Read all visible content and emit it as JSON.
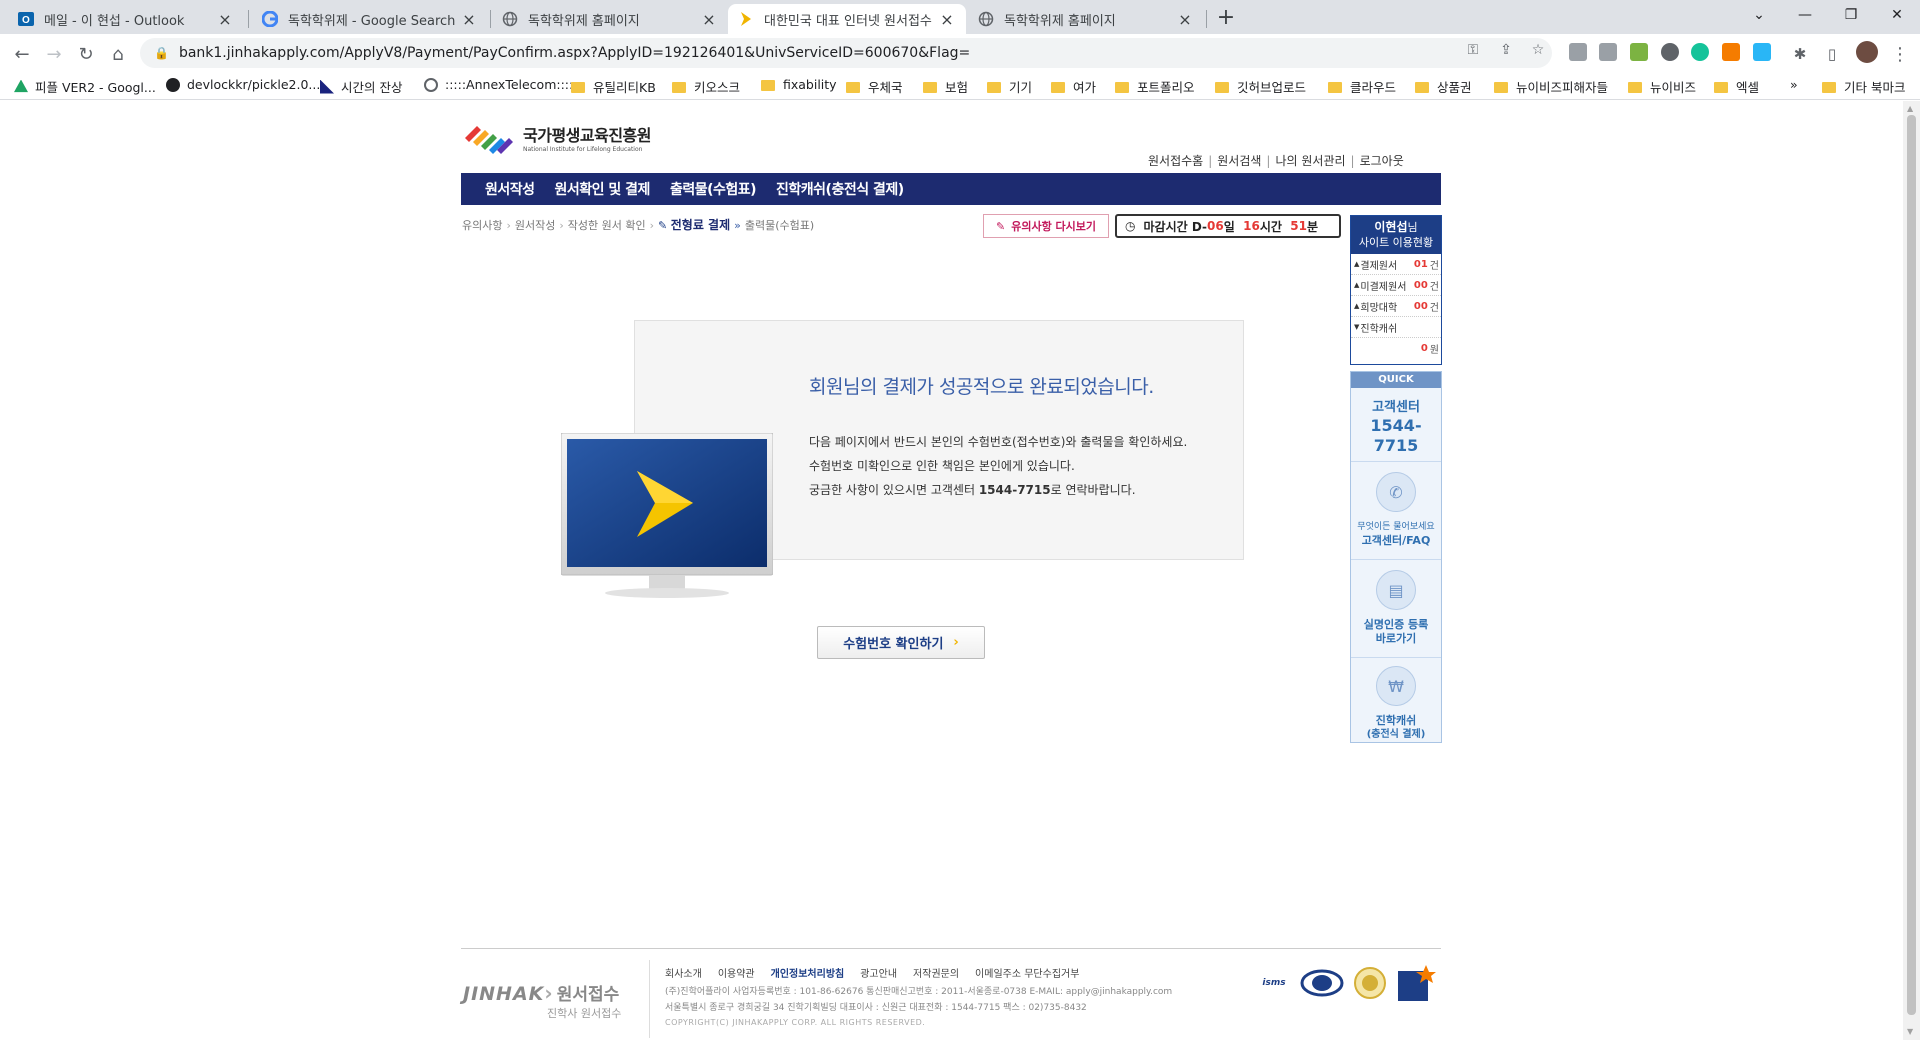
{
  "browser": {
    "tabs": [
      {
        "title": "메일 - 이 현섭 - Outlook",
        "icon": "outlook-icon"
      },
      {
        "title": "독학학위제 - Google Search",
        "icon": "google-icon"
      },
      {
        "title": "독학학위제 홈페이지",
        "icon": "globe-icon"
      },
      {
        "title": "대한민국 대표 인터넷 원서접수",
        "icon": "jinhak-icon"
      },
      {
        "title": "독학학위제 홈페이지",
        "icon": "globe-icon"
      }
    ],
    "new_tab": "+",
    "url": "bank1.jinhakapply.com/ApplyV8/Payment/PayConfirm.aspx?ApplyID=192126401&UnivServiceID=600670&Flag=",
    "bookmarks": [
      "피플 VER2 - Googl...",
      "devlockkr/pickle2.0...",
      "시간의 잔상",
      ":::::AnnexTelecom:::::",
      "유틸리티KB",
      "키오스크",
      "fixability",
      "우체국",
      "보험",
      "기기",
      "여가",
      "포트폴리오",
      "깃허브업로드",
      "클라우드",
      "상품권",
      "뉴이비즈피해자들",
      "뉴이비즈",
      "엑셀"
    ],
    "bookmarks_more": "»",
    "other_bookmarks": "기타 북마크"
  },
  "site": {
    "logo_ko": "국가평생교육진흥원",
    "logo_en": "National Institute for Lifelong Education",
    "util_links": [
      "원서접수홈",
      "원서검색",
      "나의 원서관리",
      "로그아웃"
    ],
    "nav": [
      "원서작성",
      "원서확인 및 결제",
      "출력물(수험표)",
      "진학캐쉬(충전식 결제)"
    ],
    "breadcrumb": {
      "steps_before": [
        "유의사항",
        "원서작성",
        "작성한 원서 확인"
      ],
      "current": "전형료 결제",
      "after": "출력물(수험표)"
    },
    "notice_button": "유의사항 다시보기",
    "deadline": {
      "label": "마감시간 D-",
      "days": "06",
      "day_unit": "일",
      "hours": "16",
      "hour_unit": "시간",
      "minutes": "51",
      "minute_unit": "분"
    }
  },
  "sidebar": {
    "user_name": "이현섭",
    "user_suffix": "님",
    "subtitle": "사이트 이용현황",
    "rows": [
      {
        "label": "결제원서",
        "value": "01",
        "unit": "건"
      },
      {
        "label": "미결제원서",
        "value": "00",
        "unit": "건"
      },
      {
        "label": "희망대학",
        "value": "00",
        "unit": "건"
      },
      {
        "label": "진학캐쉬",
        "value": "",
        "unit": ""
      }
    ],
    "cash_value": "0",
    "cash_unit": "원",
    "quick_title": "QUICK",
    "cs_title": "고객센터",
    "cs_phone": "1544-7715",
    "faq_line1": "무엇이든 물어보세요",
    "faq_line2": "고객센터/FAQ",
    "verify_line1": "실명인증 등록",
    "verify_line2": "바로가기",
    "cash_line1": "진학캐쉬",
    "cash_line2": "(충전식 결제)"
  },
  "main": {
    "title": "회원님의 결제가 성공적으로 완료되었습니다.",
    "line1": "다음 페이지에서 반드시 본인의 수험번호(접수번호)와 출력물을 확인하세요.",
    "line2": "수험번호 미확인으로 인한 책임은 본인에게 있습니다.",
    "line3_pre": "궁금한 사항이 있으시면 고객센터 ",
    "line3_phone": "1544-7715",
    "line3_post": "로 연락바랍니다.",
    "confirm_button": "수험번호 확인하기"
  },
  "footer": {
    "brand": "JINHAK",
    "brand_ko": "원서접수",
    "brand_sub": "진학사 원서접수",
    "links": [
      "회사소개",
      "이용약관",
      "개인정보처리방침",
      "광고안내",
      "저작권문의",
      "이메일주소 무단수집거부"
    ],
    "info1": "(주)진학어플라이 사업자등록번호 : 101-86-62676  통신판매신고번호 : 2011-서울종로-0738  E-MAIL: apply@jinhakapply.com",
    "info2": "서울특별시 종로구 경희궁길 34 진학기획빌딩   대표이사 : 신원근   대표전화 : 1544-7715   팩스 : 02)735-8432",
    "copyright": "COPYRIGHT(C) JINHAKAPPLY CORP. ALL RIGHTS RESERVED.",
    "badges": [
      "isms"
    ]
  },
  "colors": {
    "nav_bg": "#1d2b70",
    "accent_red": "#e53935",
    "title_blue": "#3a5fa8"
  }
}
